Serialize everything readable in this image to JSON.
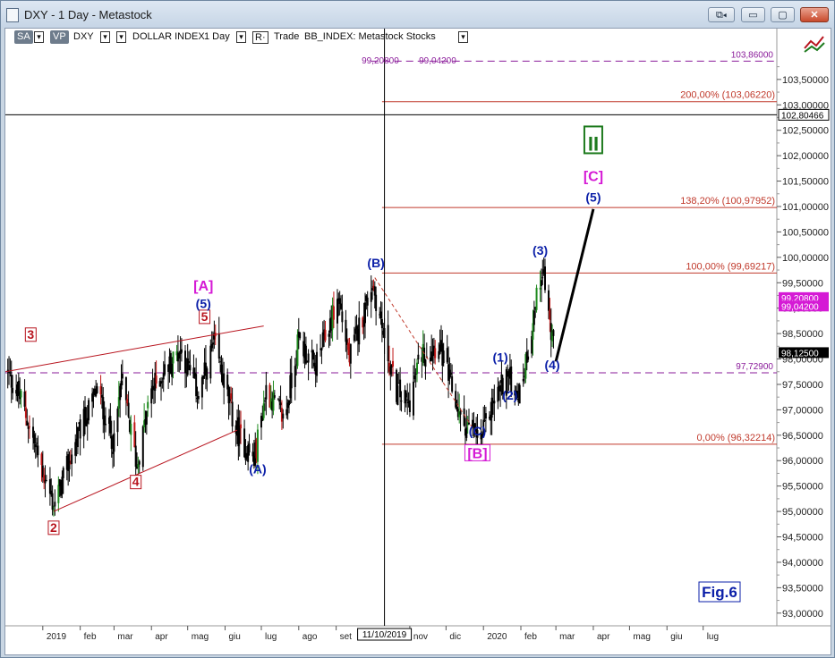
{
  "window": {
    "title": "DXY - 1 Day - Metastock",
    "buttons": {
      "restore": "⧉◂",
      "minimize": "▭",
      "maximize": "▢",
      "close": "✕"
    }
  },
  "toolbar": {
    "sa": "SA",
    "vp": "VP",
    "symbol": "DXY",
    "name": "DOLLAR INDEX",
    "period": "1 Day",
    "mode": "R·",
    "trade": "Trade",
    "feed": "BB_INDEX: Metastock Stocks",
    "arrow": "▾"
  },
  "colors": {
    "up": "#1e8a1e",
    "down": "#c01515",
    "neutral": "#000000",
    "fib": "#c0392b",
    "purple": "#8a1b9a",
    "wave_blue": "#0b1fa8",
    "wave_red": "#b8141e",
    "wave_magenta": "#d51ad5",
    "wave_green": "#1d7a1d"
  },
  "chart_data": {
    "type": "candlestick",
    "x_range": [
      "2018-12-01",
      "2020-08-31"
    ],
    "x_ticks": [
      {
        "date": "2019-01-01",
        "label": "2019"
      },
      {
        "date": "2019-02-01",
        "label": "feb"
      },
      {
        "date": "2019-03-01",
        "label": "mar"
      },
      {
        "date": "2019-04-01",
        "label": "apr"
      },
      {
        "date": "2019-05-01",
        "label": "mag"
      },
      {
        "date": "2019-06-01",
        "label": "giu"
      },
      {
        "date": "2019-07-01",
        "label": "lug"
      },
      {
        "date": "2019-08-01",
        "label": "ago"
      },
      {
        "date": "2019-09-01",
        "label": "set"
      },
      {
        "date": "2019-11-01",
        "label": "nov"
      },
      {
        "date": "2019-12-01",
        "label": "dic"
      },
      {
        "date": "2020-01-01",
        "label": "2020"
      },
      {
        "date": "2020-02-01",
        "label": "feb"
      },
      {
        "date": "2020-03-01",
        "label": "mar"
      },
      {
        "date": "2020-04-01",
        "label": "apr"
      },
      {
        "date": "2020-05-01",
        "label": "mag"
      },
      {
        "date": "2020-06-01",
        "label": "giu"
      },
      {
        "date": "2020-07-01",
        "label": "lug"
      }
    ],
    "crosshair": {
      "date": "2019-10-11",
      "label": "11/10/2019",
      "price": 102.80466,
      "price_label": "102,80466"
    },
    "y_range": [
      92.75,
      104.5
    ],
    "y_ticks": [
      "103,50000",
      "103,00000",
      "102,50000",
      "102,00000",
      "101,50000",
      "101,00000",
      "100,50000",
      "100,00000",
      "99,50000",
      "99,00000",
      "98,50000",
      "98,00000",
      "97,50000",
      "97,00000",
      "96,50000",
      "96,00000",
      "95,50000",
      "95,00000",
      "94,50000",
      "94,00000",
      "93,50000",
      "93,00000"
    ],
    "anchors": [
      {
        "date": "2018-12-01",
        "price": 97.8
      },
      {
        "date": "2018-12-14",
        "price": 97.2
      },
      {
        "date": "2019-01-10",
        "price": 95.1
      },
      {
        "date": "2019-02-01",
        "price": 96.6
      },
      {
        "date": "2019-02-15",
        "price": 97.4
      },
      {
        "date": "2019-03-01",
        "price": 96.3
      },
      {
        "date": "2019-03-07",
        "price": 97.6
      },
      {
        "date": "2019-03-20",
        "price": 95.9
      },
      {
        "date": "2019-04-01",
        "price": 97.4
      },
      {
        "date": "2019-04-25",
        "price": 98.2
      },
      {
        "date": "2019-05-10",
        "price": 97.3
      },
      {
        "date": "2019-05-23",
        "price": 98.3
      },
      {
        "date": "2019-06-10",
        "price": 96.6
      },
      {
        "date": "2019-06-25",
        "price": 96.0
      },
      {
        "date": "2019-07-05",
        "price": 97.4
      },
      {
        "date": "2019-07-20",
        "price": 96.8
      },
      {
        "date": "2019-08-01",
        "price": 98.4
      },
      {
        "date": "2019-08-14",
        "price": 97.8
      },
      {
        "date": "2019-09-03",
        "price": 99.2
      },
      {
        "date": "2019-09-12",
        "price": 98.0
      },
      {
        "date": "2019-10-01",
        "price": 99.5
      },
      {
        "date": "2019-10-20",
        "price": 97.4
      },
      {
        "date": "2019-10-31",
        "price": 97.1
      },
      {
        "date": "2019-11-10",
        "price": 98.1
      },
      {
        "date": "2019-11-25",
        "price": 98.3
      },
      {
        "date": "2019-12-13",
        "price": 96.8
      },
      {
        "date": "2019-12-30",
        "price": 96.4
      },
      {
        "date": "2020-01-08",
        "price": 97.1
      },
      {
        "date": "2020-01-20",
        "price": 97.7
      },
      {
        "date": "2020-01-31",
        "price": 97.3
      },
      {
        "date": "2020-02-19",
        "price": 99.85
      },
      {
        "date": "2020-02-27",
        "price": 98.3
      },
      {
        "date": "2020-03-01",
        "price": 98.1
      }
    ],
    "lines": [
      {
        "name": "fib-0",
        "type": "h",
        "from": "2019-10-09",
        "price": 96.32214,
        "color": "fib",
        "label": "0,00% (96,32214)"
      },
      {
        "name": "fib-100",
        "type": "h",
        "from": "2019-10-09",
        "price": 99.69217,
        "color": "fib",
        "label": "100,00% (99,69217)"
      },
      {
        "name": "fib-138",
        "type": "h",
        "from": "2019-10-09",
        "price": 100.97952,
        "color": "fib",
        "label": "138,20% (100,97952)"
      },
      {
        "name": "fib-200",
        "type": "h",
        "from": "2019-10-09",
        "price": 103.0622,
        "color": "fib",
        "label": "200,00% (103,06220)"
      },
      {
        "name": "level-9773",
        "type": "h",
        "from": "2018-12-01",
        "price": 97.729,
        "color": "purple",
        "dashed": true,
        "label": "97,72900"
      },
      {
        "name": "level-10386",
        "type": "h",
        "from": "2019-09-30",
        "price": 103.86,
        "color": "purple",
        "dashed": true,
        "label": "103,86000"
      }
    ],
    "trendlines": [
      {
        "name": "wedge-upper",
        "from": [
          "2018-12-01",
          97.75
        ],
        "to": [
          "2019-07-03",
          98.65
        ],
        "color": "#b8141e"
      },
      {
        "name": "wedge-lower",
        "from": [
          "2019-01-10",
          95.0
        ],
        "to": [
          "2019-06-11",
          96.6
        ],
        "color": "#b8141e"
      },
      {
        "name": "projection",
        "from": [
          "2020-03-01",
          97.95
        ],
        "to": [
          "2020-04-01",
          100.95
        ],
        "color": "#000000",
        "thick": true
      },
      {
        "name": "b-to-c",
        "from": [
          "2019-10-03",
          99.6
        ],
        "to": [
          "2019-12-27",
          96.5
        ],
        "color": "#c0392b",
        "dashed": true
      }
    ],
    "top_label": {
      "text1": "99,20800",
      "text2": "99,04200",
      "date": "2019-10-01",
      "price": 103.88
    },
    "price_badges": [
      {
        "text": "99,20800",
        "price": 99.208,
        "color": "#d51ad5"
      },
      {
        "text": "99,04200",
        "price": 99.042,
        "color": "#d51ad5"
      },
      {
        "text": "98,12500",
        "price": 98.125,
        "color": "#000000"
      },
      {
        "text": "102,80466",
        "price": 102.80466,
        "color": "#ffffff"
      }
    ],
    "wave_labels": [
      {
        "text": "2",
        "date": "2019-01-10",
        "price": 94.6,
        "color": "wave_red",
        "boxed": true
      },
      {
        "text": "3",
        "date": "2018-12-22",
        "price": 98.4,
        "color": "wave_red",
        "boxed": true
      },
      {
        "text": "4",
        "date": "2019-03-19",
        "price": 95.5,
        "color": "wave_red",
        "boxed": true
      },
      {
        "text": "5",
        "date": "2019-05-15",
        "price": 98.75,
        "color": "wave_red",
        "boxed": true
      },
      {
        "text": "(5)",
        "date": "2019-05-14",
        "price": 99.0,
        "color": "wave_blue"
      },
      {
        "text": "[A]",
        "date": "2019-05-14",
        "price": 99.35,
        "color": "wave_magenta"
      },
      {
        "text": "(A)",
        "date": "2019-06-28",
        "price": 95.75,
        "color": "wave_blue"
      },
      {
        "text": "(B)",
        "date": "2019-10-04",
        "price": 99.8,
        "color": "wave_blue"
      },
      {
        "text": "(C)",
        "date": "2019-12-27",
        "price": 96.5,
        "color": "wave_blue"
      },
      {
        "text": "[B]",
        "date": "2019-12-27",
        "price": 96.05,
        "color": "wave_magenta",
        "boxed": true
      },
      {
        "text": "(1)",
        "date": "2020-01-15",
        "price": 97.95,
        "color": "wave_blue"
      },
      {
        "text": "(2)",
        "date": "2020-01-23",
        "price": 97.2,
        "color": "wave_blue"
      },
      {
        "text": "(3)",
        "date": "2020-02-17",
        "price": 100.05,
        "color": "wave_blue"
      },
      {
        "text": "(4)",
        "date": "2020-02-27",
        "price": 97.8,
        "color": "wave_blue"
      },
      {
        "text": "(5)",
        "date": "2020-04-01",
        "price": 101.1,
        "color": "wave_blue"
      },
      {
        "text": "[C]",
        "date": "2020-04-01",
        "price": 101.5,
        "color": "wave_magenta"
      },
      {
        "text": "II",
        "date": "2020-04-01",
        "price": 102.1,
        "color": "wave_green",
        "boxed": true
      }
    ],
    "figure_label": "Fig.6"
  }
}
